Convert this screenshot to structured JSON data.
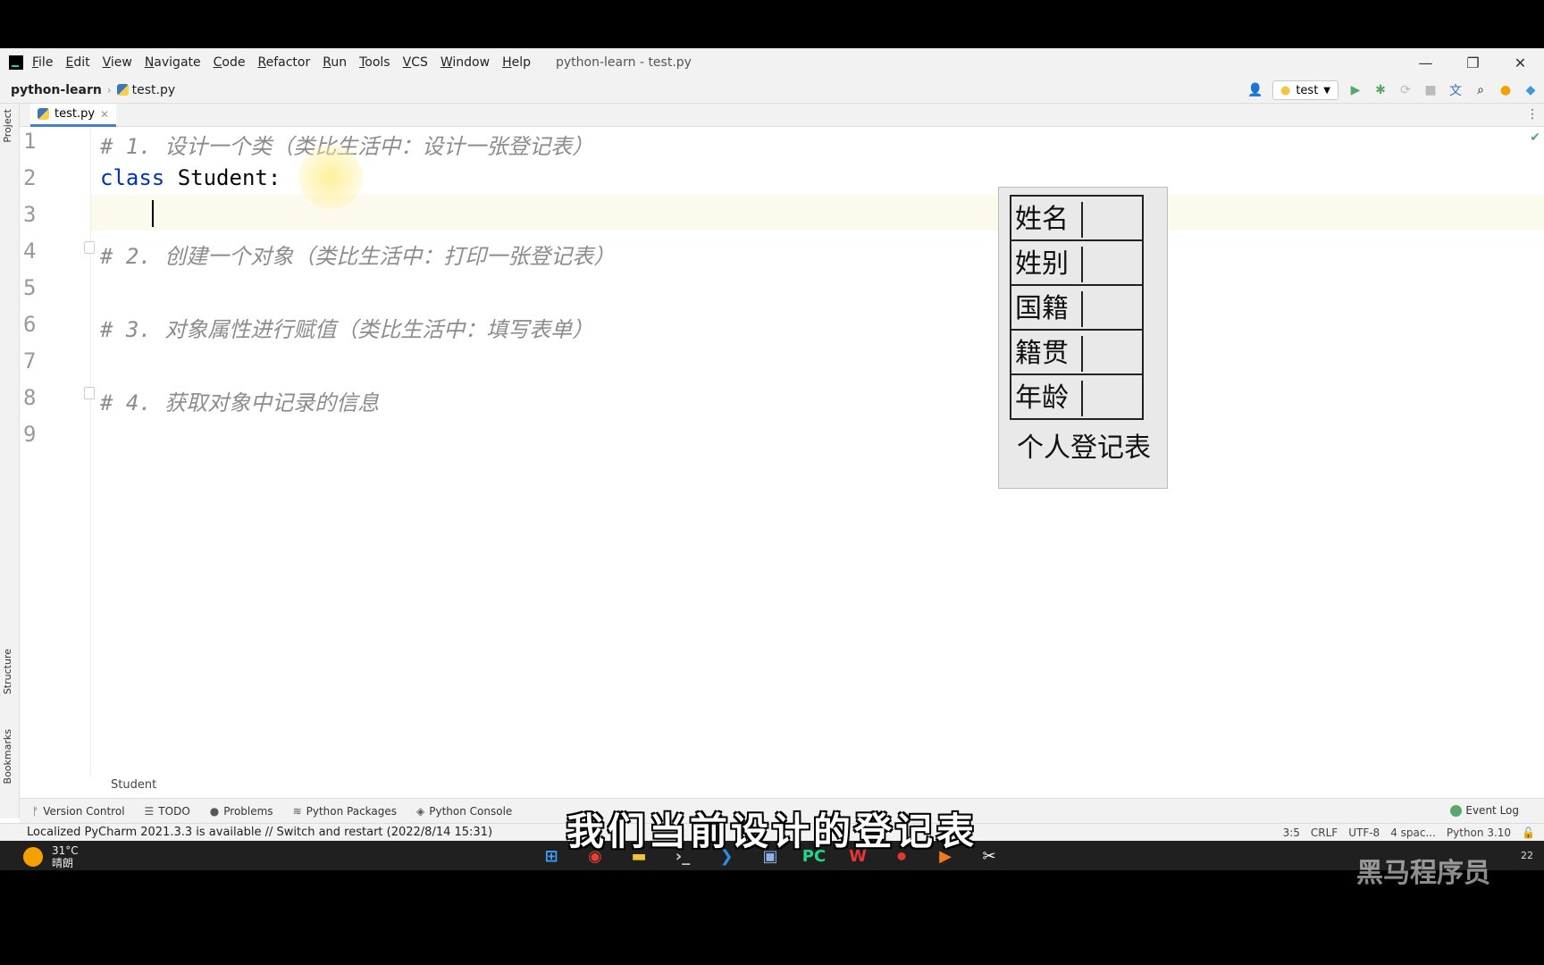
{
  "menubar": {
    "items": [
      "File",
      "Edit",
      "View",
      "Navigate",
      "Code",
      "Refactor",
      "Run",
      "Tools",
      "VCS",
      "Window",
      "Help"
    ],
    "window_title": "python-learn - test.py",
    "minimize": "—",
    "restore": "❐",
    "close": "✕"
  },
  "navbar": {
    "project": "python-learn",
    "file": "test.py",
    "run_config": "test"
  },
  "left_strip": {
    "project": "Project",
    "structure": "Structure",
    "bookmarks": "Bookmarks"
  },
  "tabs": [
    {
      "label": "test.py",
      "close": "✕"
    }
  ],
  "editor": {
    "line_numbers": [
      "1",
      "2",
      "3",
      "4",
      "5",
      "6",
      "7",
      "8",
      "9"
    ],
    "lines": [
      "# 1. 设计一个类（类比生活中：设计一张登记表）",
      "class",
      " Student:",
      "",
      "# 2. 创建一个对象（类比生活中：打印一张登记表）",
      "",
      "# 3. 对象属性进行赋值（类比生活中：填写表单）",
      "",
      "# 4. 获取对象中记录的信息",
      ""
    ]
  },
  "form_image": {
    "rows": [
      "姓名",
      "姓别",
      "国籍",
      "籍贯",
      "年龄"
    ],
    "footer": "个人登记表"
  },
  "editor_breadcrumb": "Student",
  "toolwindows": {
    "items": [
      "Version Control",
      "TODO",
      "Problems",
      "Python Packages",
      "Python Console"
    ],
    "event_log": "Event Log"
  },
  "statusbar": {
    "message": "Localized PyCharm 2021.3.3 is available // Switch and restart (2022/8/14 15:31)",
    "position": "3:5",
    "line_sep": "CRLF",
    "encoding": "UTF-8",
    "indent": "4 spac...",
    "interpreter": "Python 3.10"
  },
  "taskbar": {
    "temp": "31°C",
    "weather": "晴朗",
    "num": "22"
  },
  "subtitle": "我们当前设计的登记表",
  "watermark": "黑马程序员"
}
